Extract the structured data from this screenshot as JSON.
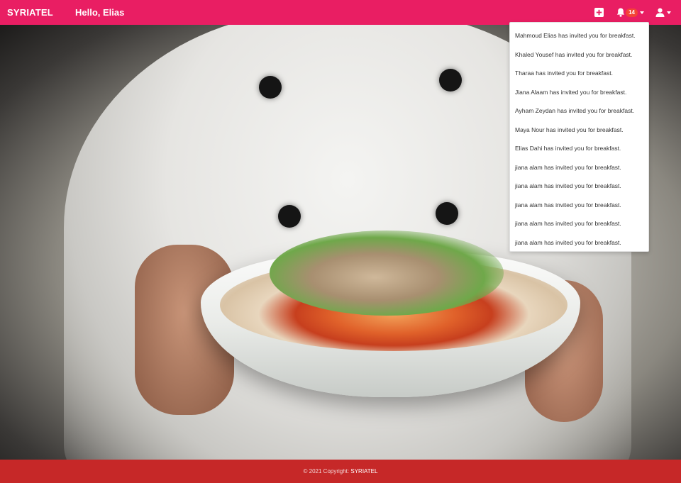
{
  "navbar": {
    "brand": "SYRIATEL",
    "greeting": "Hello, Elias",
    "notification_count": "14",
    "background_color": "#e91e63"
  },
  "icons": [
    "plus-square-icon",
    "bell-icon",
    "user-icon",
    "caret-down-icon"
  ],
  "notifications": [
    "Mahmoud Elias has invited you for breakfast.",
    "Khaled Yousef has invited you for breakfast.",
    "Tharaa has invited you for breakfast.",
    "Jiana Alaam has invited you for breakfast.",
    "Ayham Zeydan has invited you for breakfast.",
    "Maya Nour has invited you for breakfast.",
    "Elias Dahi has invited you for breakfast.",
    "jiana alam has invited you for breakfast.",
    "jiana alam has invited you for breakfast.",
    "jiana alam has invited you for breakfast.",
    "jiana alam has invited you for breakfast.",
    "jiana alam has invited you for breakfast."
  ],
  "footer": {
    "copyright": "© 2021 Copyright:",
    "brand": "SYRIATEL",
    "background_color": "#c62828"
  }
}
